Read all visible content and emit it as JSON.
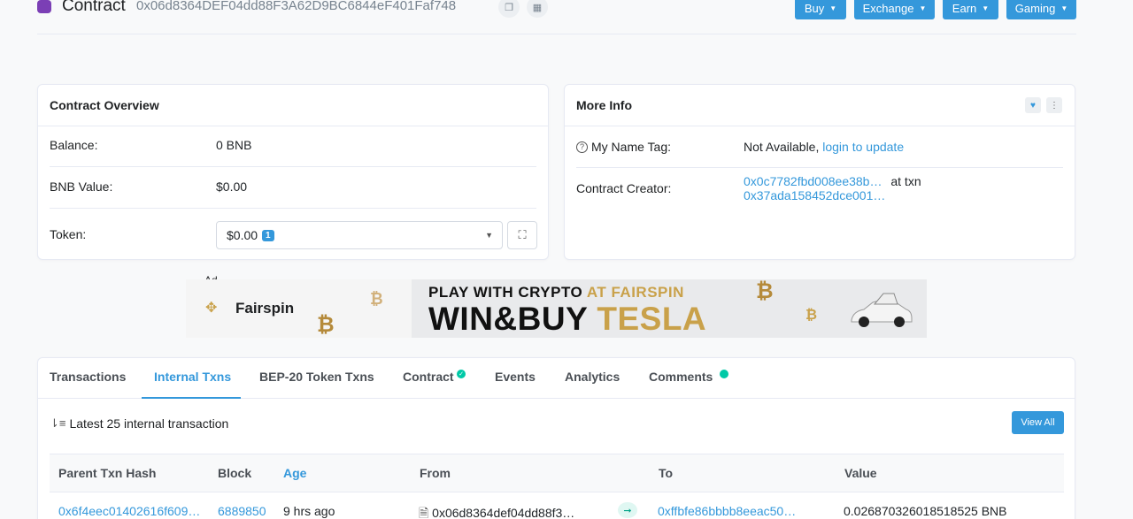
{
  "header": {
    "title": "Contract",
    "address": "0x06d8364DEF04dd88F3A62D9BC6844eF401Faf748",
    "menu": [
      {
        "label": "Buy"
      },
      {
        "label": "Exchange"
      },
      {
        "label": "Earn"
      },
      {
        "label": "Gaming"
      }
    ]
  },
  "overview": {
    "title": "Contract Overview",
    "balance_label": "Balance:",
    "balance_value": "0 BNB",
    "bnb_value_label": "BNB Value:",
    "bnb_value": "$0.00",
    "token_label": "Token:",
    "token_value": "$0.00",
    "token_count": "1"
  },
  "more_info": {
    "title": "More Info",
    "name_tag_label": "My Name Tag:",
    "name_tag_value": "Not Available,",
    "name_tag_link": "login to update",
    "creator_label": "Contract Creator:",
    "creator_address": "0x0c7782fbd008ee38b…",
    "at_txn": "at txn",
    "creator_txn": "0x37ada158452dce001…"
  },
  "ad": {
    "label": "Ad",
    "brand": "Fairspin",
    "line1_a": "PLAY WITH CRYPTO",
    "line1_b": "AT FAIRSPIN",
    "line2_a": "WIN&BUY",
    "line2_b": "TESLA"
  },
  "tabs": [
    {
      "label": "Transactions"
    },
    {
      "label": "Internal Txns"
    },
    {
      "label": "BEP-20 Token Txns"
    },
    {
      "label": "Contract"
    },
    {
      "label": "Events"
    },
    {
      "label": "Analytics"
    },
    {
      "label": "Comments"
    }
  ],
  "internal": {
    "latest_text": "Latest 25 internal transaction",
    "view_all": "View All",
    "columns": [
      "Parent Txn Hash",
      "Block",
      "Age",
      "From",
      "To",
      "Value"
    ],
    "rows": [
      {
        "parent_hash": "0x6f4eec01402616f609…",
        "block": "6889850",
        "age": "9 hrs ago",
        "from": "0x06d8364def04dd88f3…",
        "to": "0xffbfe86bbbb8eeac50…",
        "value": "0.026870326018518525 BNB"
      }
    ]
  },
  "colors": {
    "accent": "#3498db",
    "success": "#00c9a7",
    "ad_gold": "#c9a14a"
  }
}
